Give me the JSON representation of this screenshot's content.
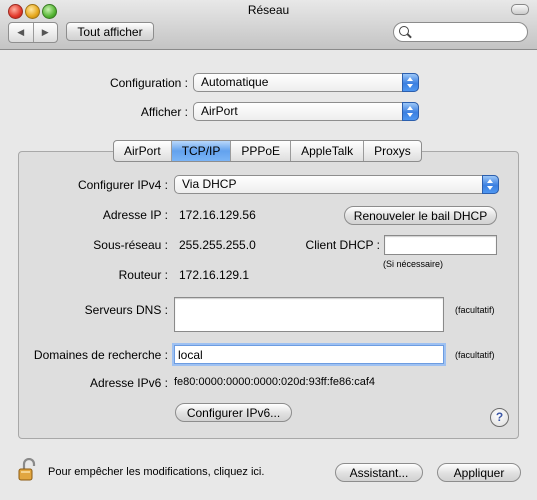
{
  "window": {
    "title": "Réseau"
  },
  "toolbar": {
    "back_label": "◀",
    "forward_label": "▶",
    "show_all_label": "Tout afficher",
    "search_value": ""
  },
  "header": {
    "configuration_label": "Configuration :",
    "configuration_value": "Automatique",
    "show_label": "Afficher :",
    "show_value": "AirPort"
  },
  "tabs": [
    {
      "label": "AirPort",
      "selected": false
    },
    {
      "label": "TCP/IP",
      "selected": true
    },
    {
      "label": "PPPoE",
      "selected": false
    },
    {
      "label": "AppleTalk",
      "selected": false
    },
    {
      "label": "Proxys",
      "selected": false
    }
  ],
  "tcpip": {
    "configure_ipv4_label": "Configurer IPv4 :",
    "configure_ipv4_value": "Via DHCP",
    "ip_label": "Adresse IP :",
    "ip_value": "172.16.129.56",
    "renew_label": "Renouveler le bail DHCP",
    "subnet_label": "Sous-réseau :",
    "subnet_value": "255.255.255.0",
    "dhcp_client_label": "Client DHCP :",
    "dhcp_client_value": "",
    "if_needed": "(Si nécessaire)",
    "router_label": "Routeur :",
    "router_value": "172.16.129.1",
    "dns_label": "Serveurs DNS :",
    "dns_value": "",
    "optional_1": "(facultatif)",
    "search_domains_label": "Domaines de recherche :",
    "search_domains_value": "local",
    "optional_2": "(facultatif)",
    "ipv6_label": "Adresse IPv6 :",
    "ipv6_value": "fe80:0000:0000:0000:020d:93ff:fe86:caf4",
    "configure_ipv6_label": "Configurer IPv6...",
    "help_label": "?"
  },
  "footer": {
    "lock_text": "Pour empêcher les modifications, cliquez ici.",
    "assistant_label": "Assistant...",
    "apply_label": "Appliquer"
  },
  "colors": {
    "accent": "#3b7fe0",
    "tab_selected": "#63a2ee"
  }
}
